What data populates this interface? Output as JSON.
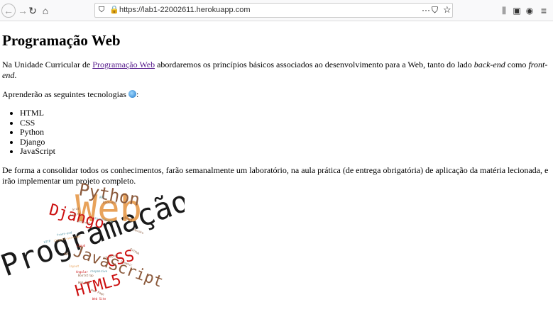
{
  "browser": {
    "url": "https://lab1-22002611.herokuapp.com"
  },
  "page": {
    "title": "Programação Web",
    "intro_before": "Na Unidade Curricular de ",
    "intro_link": "Programação Web",
    "intro_after1": " abordaremos os princípios básicos associados ao desenvolvimento para a Web, tanto do lado ",
    "intro_em1": "back-end",
    "intro_after2": " como ",
    "intro_em2": "front-end",
    "intro_end": ".",
    "tech_intro": "Aprenderão as seguintes tecnologias ",
    "tech_colon": ":",
    "technologies": [
      "HTML",
      "CSS",
      "Python",
      "Django",
      "JavaScript"
    ],
    "closing": "De forma a consolidar todos os conhecimentos, farão semanalmente um laboratório, na aula prática (de entrega obrigatória) de aplicação da matéria lecionada, e irão implementar um projeto completo."
  },
  "word_cloud": {
    "words": [
      "Programação",
      "Web",
      "Python",
      "Django",
      "CSS",
      "JavaScript",
      "HTML5",
      "API",
      "back-end",
      "Grid",
      "Svelte",
      "Internet",
      "formulários",
      "React",
      "Heroku",
      "front-end",
      "HTTP",
      "cliente-servidor",
      "Cloud",
      "MVC",
      "GitHub",
      "animações",
      "Dynamic",
      "layout",
      "Angular",
      "responsive",
      "Bootstrap",
      "Web App",
      "Web Page",
      "Web Site"
    ],
    "colors": {
      "black": "#1a1a1a",
      "orange": "#e8a25a",
      "brown": "#8b5a3c",
      "red": "#cc1010",
      "teal": "#4a8fa0"
    }
  }
}
